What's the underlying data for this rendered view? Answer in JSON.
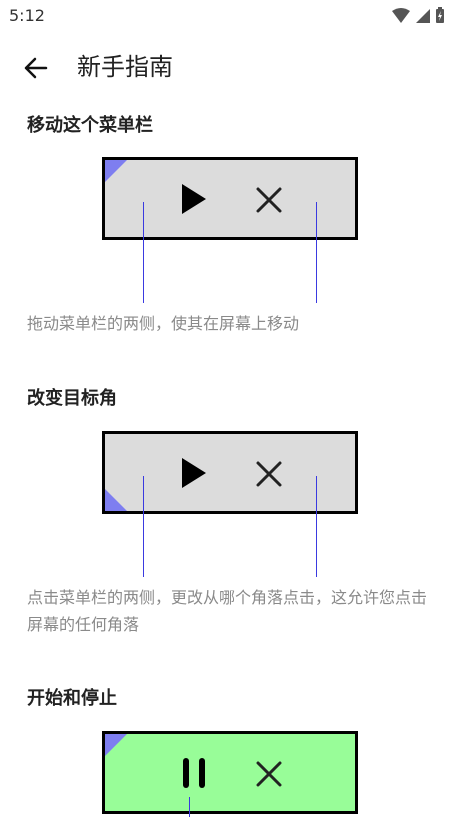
{
  "status_bar": {
    "time": "5:12"
  },
  "header": {
    "title": "新手指南",
    "back_icon": "arrow-left-icon"
  },
  "sections": [
    {
      "heading": "移动这个菜单栏",
      "description": "拖动菜单栏的两侧，使其在屏幕上移动",
      "bar_state": "play",
      "bar_color": "#dcdcdc"
    },
    {
      "heading": "改变目标角",
      "description": "点击菜单栏的两侧，更改从哪个角落点击，这允许您点击屏幕的任何角落",
      "bar_state": "play",
      "bar_color": "#dcdcdc"
    },
    {
      "heading": "开始和停止",
      "bar_state": "pause",
      "bar_color": "#98fd98"
    }
  ],
  "colors": {
    "corner_marker": "#7e7ef0",
    "pointer_line": "#3a3ae0",
    "description_text": "#8a8a8a"
  }
}
